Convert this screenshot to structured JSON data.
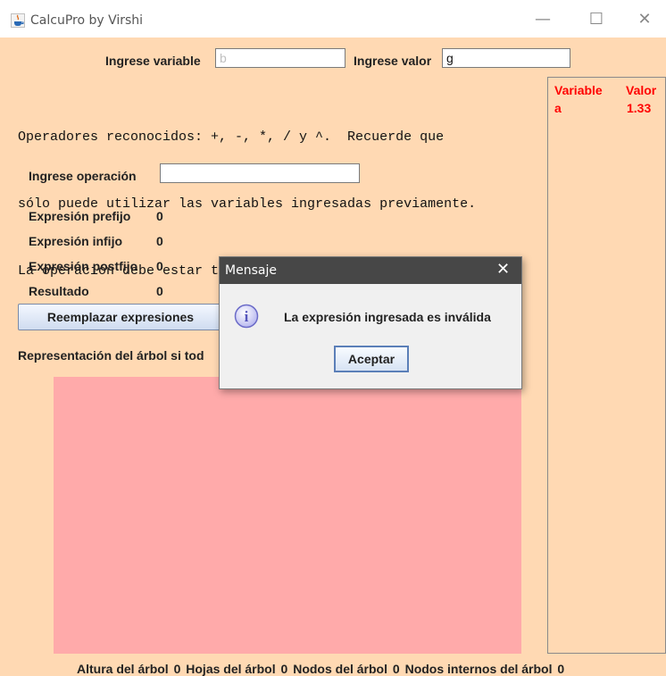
{
  "window": {
    "title": "CalcuPro by Virshi",
    "minimize_icon": "—",
    "maximize_icon": "☐",
    "close_icon": "✕"
  },
  "inputs": {
    "variable_label": "Ingrese variable",
    "variable_value": "b",
    "value_label": "Ingrese valor",
    "value_value": "g",
    "operation_label": "Ingrese operación",
    "operation_value": ""
  },
  "instructions": [
    "Operadores reconocidos: +, -, *, / y ^.  Recuerde que",
    "sólo puede utilizar las variables ingresadas previamente.",
    "La operación debe estar totalmente parentizada."
  ],
  "results": {
    "prefix_label": "Expresión prefijo",
    "prefix_value": "0",
    "infix_label": "Expresión infijo",
    "infix_value": "0",
    "postfix_label": "Expresión postfijo",
    "postfix_value": "0",
    "result_label": "Resultado",
    "result_value": "0"
  },
  "replace_button": "Reemplazar expresiones",
  "tree_label": "Representación del árbol si tod",
  "variables_table": {
    "headers": [
      "Variable",
      "Valor"
    ],
    "rows": [
      [
        "a",
        "1.33"
      ]
    ]
  },
  "footer": {
    "height_label": "Altura del árbol",
    "height_value": "0",
    "leaves_label": "Hojas del árbol",
    "leaves_value": "0",
    "nodes_label": "Nodos del árbol",
    "nodes_value": "0",
    "internal_label": "Nodos internos del árbol",
    "internal_value": "0"
  },
  "dialog": {
    "title": "Mensaje",
    "close_icon": "✕",
    "message": "La expresión ingresada es inválida",
    "button": "Aceptar",
    "icon_glyph": "i"
  },
  "colors": {
    "background": "#ffd9b3",
    "tree_area": "#ffaaaa",
    "table_text": "#ff0000",
    "dialog_titlebar": "#474747"
  }
}
